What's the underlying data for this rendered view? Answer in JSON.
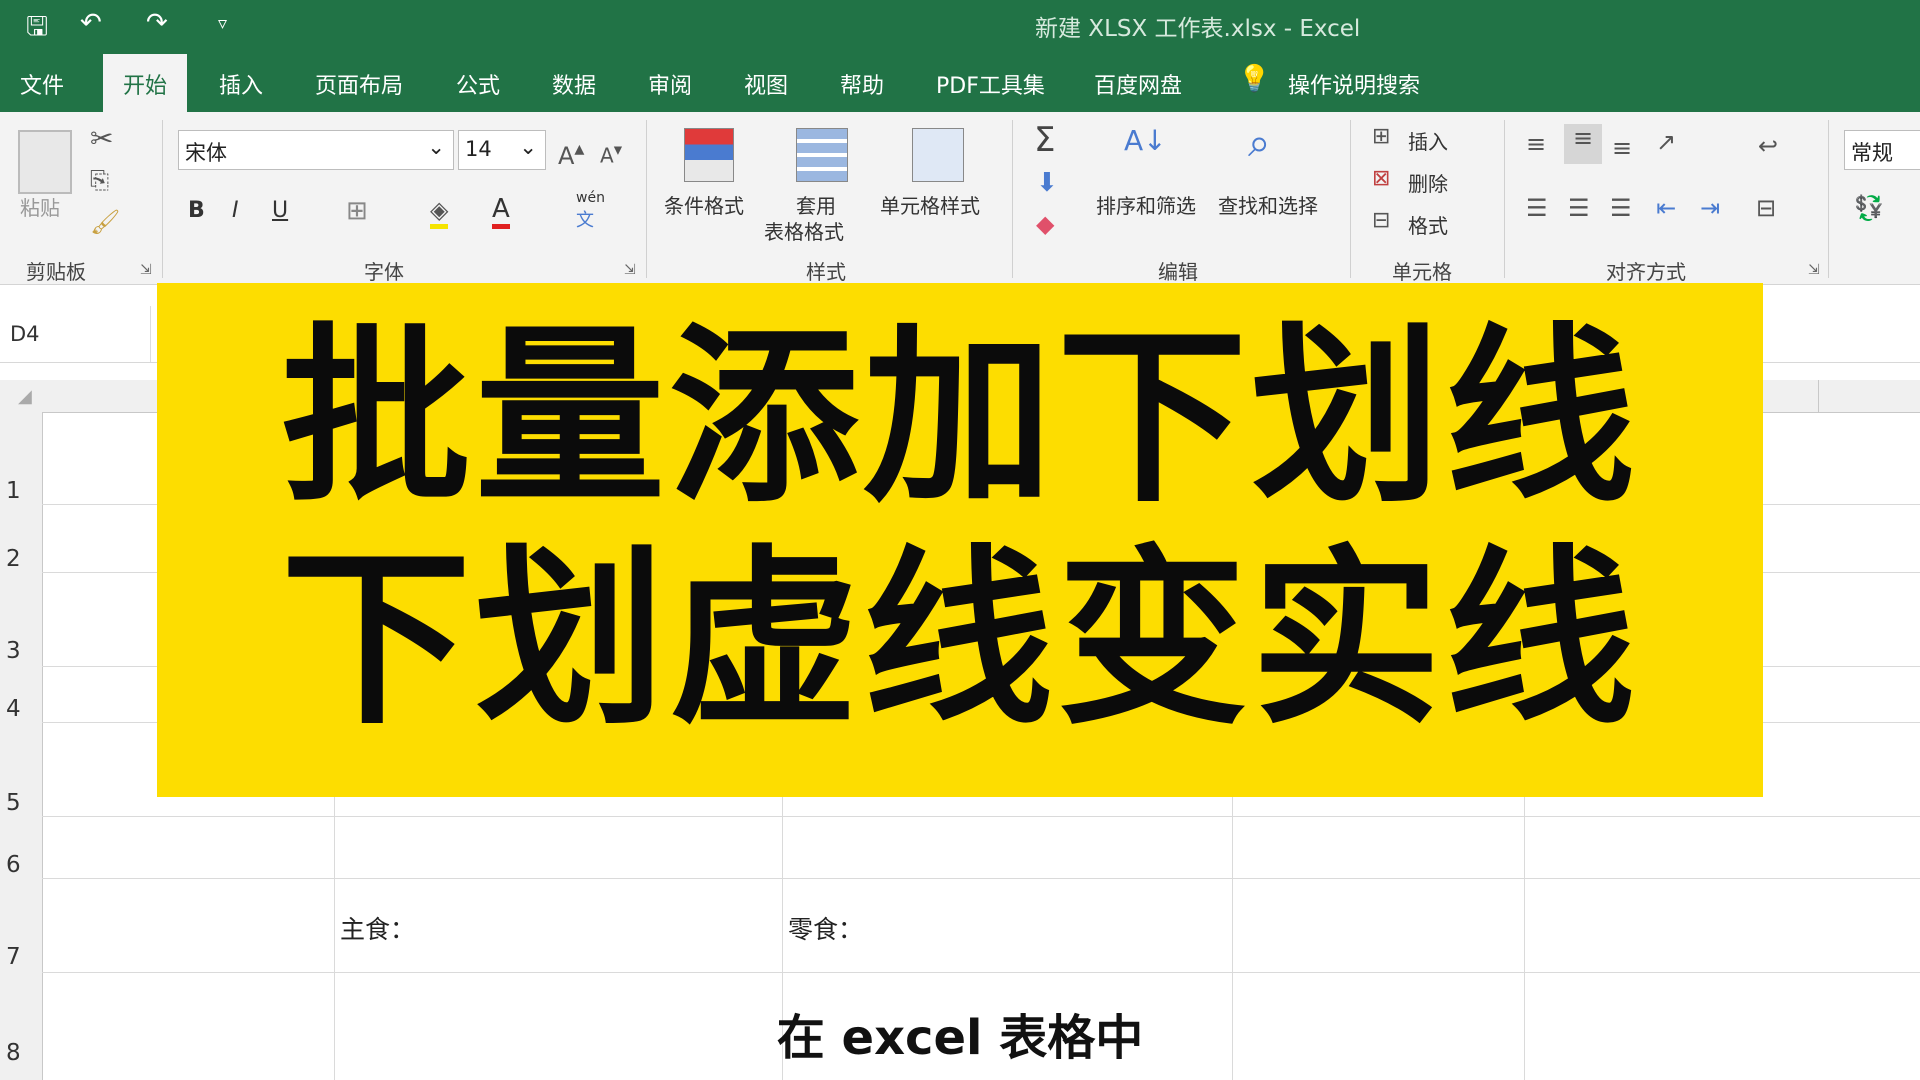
{
  "window": {
    "title": "新建 XLSX 工作表.xlsx  -  Excel"
  },
  "quick_access": {
    "save": "🖫",
    "undo": "↶",
    "redo": "↷",
    "customize": "▿"
  },
  "tabs": [
    "文件",
    "开始",
    "插入",
    "页面布局",
    "公式",
    "数据",
    "审阅",
    "视图",
    "帮助",
    "PDF工具集",
    "百度网盘",
    "操作说明搜索"
  ],
  "ribbon": {
    "clipboard": {
      "paste": "粘贴",
      "group": "剪贴板"
    },
    "font": {
      "name": "宋体",
      "size": "14",
      "bold": "B",
      "italic": "I",
      "underline": "U",
      "group": "字体",
      "phonetic_top": "wén",
      "phonetic_bottom": "文"
    },
    "styles": {
      "conditional": "条件格式",
      "table_top": "套用",
      "table_bottom": "表格格式",
      "cell_styles": "单元格样式",
      "group": "样式"
    },
    "editing": {
      "sort": "排序和筛选",
      "find": "查找和选择",
      "group": "编辑"
    },
    "cells": {
      "insert": "插入",
      "delete": "删除",
      "format": "格式",
      "group": "单元格"
    },
    "alignment": {
      "group": "对齐方式"
    },
    "number": {
      "format": "常规"
    }
  },
  "formula_bar": {
    "name_box": "D4"
  },
  "rows": [
    "1",
    "2",
    "3",
    "4",
    "5",
    "6",
    "7",
    "8"
  ],
  "cells": {
    "staple": "主食：",
    "snack": "零食："
  },
  "banner": {
    "line1": "批量添加下划线",
    "line2": "下划虚线变实线"
  },
  "caption": "在 excel 表格中",
  "colors": {
    "excel_green": "#217346",
    "banner_yellow": "#fddd00"
  }
}
